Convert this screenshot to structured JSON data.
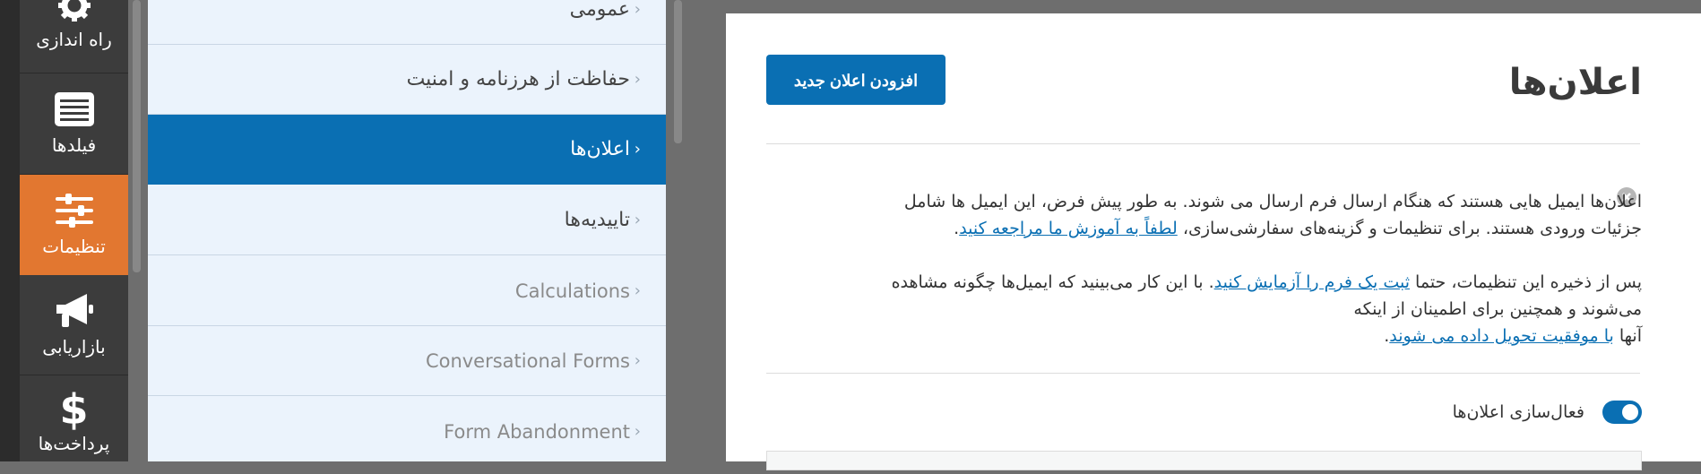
{
  "iconbar": {
    "items": [
      {
        "label": "راه اندازی",
        "icon": "gear-icon"
      },
      {
        "label": "فیلدها",
        "icon": "list-icon"
      },
      {
        "label": "تنظیمات",
        "icon": "sliders-icon",
        "active": true
      },
      {
        "label": "بازاریابی",
        "icon": "megaphone-icon"
      },
      {
        "label": "پرداخت‌ها",
        "icon": "dollar-icon"
      }
    ]
  },
  "settings": {
    "items": [
      {
        "label": "عمومی"
      },
      {
        "label": "حفاظت از هرزنامه و امنیت"
      },
      {
        "label": "اعلان‌ها",
        "active": true
      },
      {
        "label": "تاییدیه‌ها"
      },
      {
        "label": "Calculations"
      },
      {
        "label": "Conversational Forms"
      },
      {
        "label": "Form Abandonment"
      }
    ],
    "chevron": "‹"
  },
  "content": {
    "title": "اعلان‌ها",
    "add_button": "افزودن اعلان جدید",
    "notice": {
      "p1_line1": "اعلان‌ها ایمیل هایی هستند که هنگام ارسال فرم ارسال می شوند. به طور پیش فرض، این ایمیل ها شامل",
      "p1_line2_text": "جزئیات ورودی هستند. برای تنظیمات و گزینه‌های سفارشی‌سازی، ",
      "p1_link": "لطفاً به آموزش ما مراجعه کنید",
      "p1_end": ".",
      "p2_text1": "پس از ذخیره این تنظیمات، حتما ",
      "p2_link1": "ثبت یک فرم را آزمایش کنید",
      "p2_text2": ". با این کار می‌بینید که ایمیل‌ها چگونه مشاهده",
      "p2_line2": "می‌شوند و همچنین برای اطمینان از اینکه",
      "p2_text3": "آنها ",
      "p2_link2": "با موفقیت تحویل داده می شوند",
      "p2_end": "."
    },
    "toggle": {
      "label": "فعال‌سازی اعلان‌ها",
      "enabled": true
    }
  },
  "colors": {
    "accent": "#0a6fb3",
    "active_icon": "#e27730"
  }
}
